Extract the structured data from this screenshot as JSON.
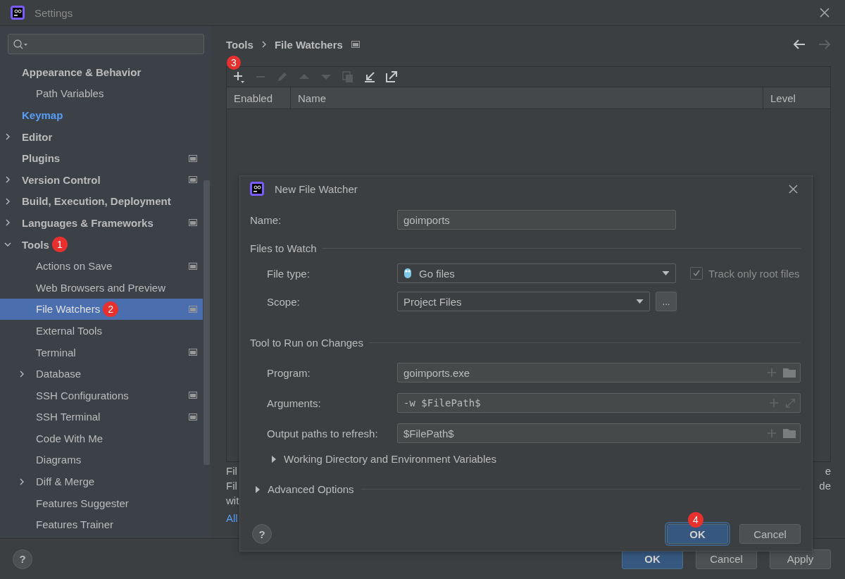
{
  "window": {
    "title": "Settings"
  },
  "sidebar": {
    "items": [
      {
        "label": "Appearance & Behavior",
        "selected": false,
        "highlighted": false,
        "project_level": false,
        "children": [
          {
            "label": "Path Variables",
            "selected": false,
            "highlighted": false,
            "project_level": false
          }
        ]
      },
      {
        "label": "Keymap",
        "selected": false,
        "highlighted": true,
        "project_level": false
      },
      {
        "label": "Editor",
        "selected": false,
        "highlighted": false,
        "project_level": false,
        "expanded": false
      },
      {
        "label": "Plugins",
        "selected": false,
        "highlighted": false,
        "project_level": true
      },
      {
        "label": "Version Control",
        "selected": false,
        "highlighted": false,
        "project_level": true,
        "expanded": false
      },
      {
        "label": "Build, Execution, Deployment",
        "selected": false,
        "highlighted": false,
        "project_level": false,
        "expanded": false
      },
      {
        "label": "Languages & Frameworks",
        "selected": false,
        "highlighted": false,
        "project_level": true,
        "expanded": false
      },
      {
        "label": "Tools",
        "selected": false,
        "highlighted": false,
        "project_level": false,
        "expanded": true,
        "marker": "1",
        "children": [
          {
            "label": "Actions on Save",
            "selected": false,
            "highlighted": false,
            "project_level": true
          },
          {
            "label": "Web Browsers and Preview",
            "selected": false,
            "highlighted": false,
            "project_level": false
          },
          {
            "label": "File Watchers",
            "selected": true,
            "highlighted": false,
            "project_level": true,
            "marker": "2"
          },
          {
            "label": "External Tools",
            "selected": false,
            "highlighted": false,
            "project_level": false
          },
          {
            "label": "Terminal",
            "selected": false,
            "highlighted": false,
            "project_level": true
          },
          {
            "label": "Database",
            "selected": false,
            "highlighted": false,
            "project_level": false,
            "expanded": false
          },
          {
            "label": "SSH Configurations",
            "selected": false,
            "highlighted": false,
            "project_level": true
          },
          {
            "label": "SSH Terminal",
            "selected": false,
            "highlighted": false,
            "project_level": true
          },
          {
            "label": "Code With Me",
            "selected": false,
            "highlighted": false,
            "project_level": false
          },
          {
            "label": "Diagrams",
            "selected": false,
            "highlighted": false,
            "project_level": false
          },
          {
            "label": "Diff & Merge",
            "selected": false,
            "highlighted": false,
            "project_level": false,
            "expanded": false
          },
          {
            "label": "Features Suggester",
            "selected": false,
            "highlighted": false,
            "project_level": false
          },
          {
            "label": "Features Trainer",
            "selected": false,
            "highlighted": false,
            "project_level": false
          }
        ]
      }
    ]
  },
  "breadcrumb": [
    "Tools",
    "File Watchers"
  ],
  "navigation": [
    {
      "kind": "back",
      "disabled": false
    },
    {
      "kind": "forward",
      "disabled": true
    }
  ],
  "toolbar": [
    {
      "kind": "add",
      "disabled": false,
      "marker": "3"
    },
    {
      "kind": "remove",
      "disabled": true
    },
    {
      "kind": "edit",
      "disabled": true
    },
    {
      "kind": "up",
      "disabled": true
    },
    {
      "kind": "down",
      "disabled": true
    },
    {
      "kind": "copy",
      "disabled": true
    },
    {
      "kind": "import",
      "disabled": false
    },
    {
      "kind": "export",
      "disabled": false
    }
  ],
  "table": {
    "columns": [
      "Enabled",
      "Name",
      "Level"
    ]
  },
  "description_fragments": {
    "left": [
      "Fil",
      "Fil",
      "wit"
    ],
    "link": "All",
    "right": [
      "e",
      "de"
    ]
  },
  "dialog": {
    "title": "New File Watcher",
    "name": {
      "label": "Name:",
      "value": "goimports"
    },
    "files_section": "Files to Watch",
    "file_type": {
      "label": "File type:",
      "value": "Go files"
    },
    "track_root": {
      "label": "Track only root files",
      "checked": true,
      "disabled": true
    },
    "scope": {
      "label": "Scope:",
      "value": "Project Files",
      "button": "..."
    },
    "tool_section": "Tool to Run on Changes",
    "tool_fields": [
      {
        "label": "Program:",
        "value": "goimports.exe",
        "kind": "browse",
        "mono": false
      },
      {
        "label": "Arguments:",
        "value": "-w $FilePath$",
        "kind": "expand",
        "mono": true
      },
      {
        "label": "Output paths to refresh:",
        "value": "$FilePath$",
        "kind": "browse",
        "mono": false
      }
    ],
    "working_dir": {
      "label": "Working Directory and Environment Variables",
      "expanded": false
    },
    "advanced": {
      "label": "Advanced Options",
      "expanded": false
    },
    "ok": {
      "label": "OK",
      "marker": "4"
    },
    "cancel": "Cancel",
    "help": "?"
  },
  "footer": {
    "help": "?",
    "buttons": [
      {
        "label": "OK",
        "kind": "primary"
      },
      {
        "label": "Cancel",
        "kind": "normal"
      },
      {
        "label": "Apply",
        "kind": "normal"
      }
    ]
  }
}
